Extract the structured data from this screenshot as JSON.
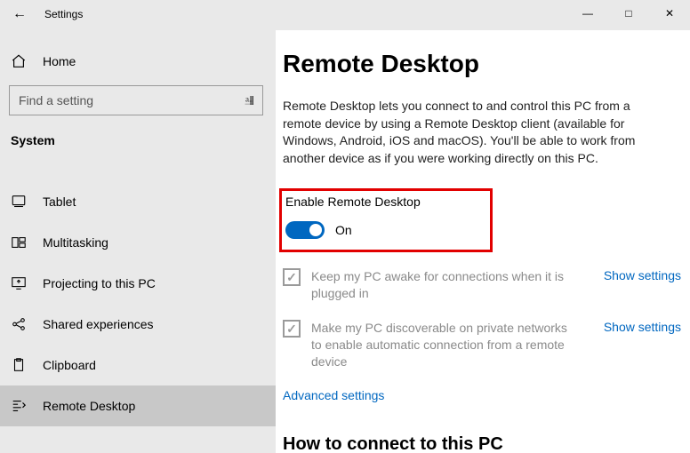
{
  "app_title": "Settings",
  "home_label": "Home",
  "search_placeholder": "Find a setting",
  "category": "System",
  "nav": [
    {
      "key": "tablet",
      "label": "Tablet"
    },
    {
      "key": "multitasking",
      "label": "Multitasking"
    },
    {
      "key": "projecting",
      "label": "Projecting to this PC"
    },
    {
      "key": "shared",
      "label": "Shared experiences"
    },
    {
      "key": "clipboard",
      "label": "Clipboard"
    },
    {
      "key": "remote",
      "label": "Remote Desktop"
    }
  ],
  "page": {
    "title": "Remote Desktop",
    "intro": "Remote Desktop lets you connect to and control this PC from a remote device by using a Remote Desktop client (available for Windows, Android, iOS and macOS). You'll be able to work from another device as if you were working directly on this PC.",
    "enable_label": "Enable Remote Desktop",
    "toggle_state": "On",
    "option1": "Keep my PC awake for connections when it is plugged in",
    "option2": "Make my PC discoverable on private networks to enable automatic connection from a remote device",
    "show_settings": "Show settings",
    "advanced": "Advanced settings",
    "how_to": "How to connect to this PC"
  }
}
